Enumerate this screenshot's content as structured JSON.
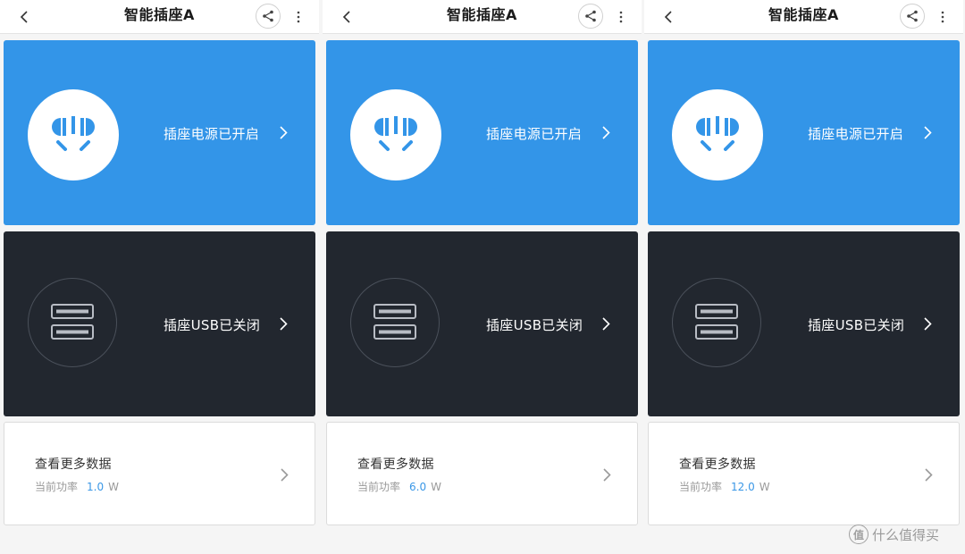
{
  "panels": [
    {
      "title": "智能插座A",
      "power_card": {
        "label": "插座电源已开启",
        "state": "on"
      },
      "usb_card": {
        "label": "插座USB已关闭",
        "state": "off"
      },
      "data_card": {
        "title": "查看更多数据",
        "power_label": "当前功率",
        "power_value": "1.0",
        "power_unit": "W"
      }
    },
    {
      "title": "智能插座A",
      "power_card": {
        "label": "插座电源已开启",
        "state": "on"
      },
      "usb_card": {
        "label": "插座USB已关闭",
        "state": "off"
      },
      "data_card": {
        "title": "查看更多数据",
        "power_label": "当前功率",
        "power_value": "6.0",
        "power_unit": "W"
      }
    },
    {
      "title": "智能插座A",
      "power_card": {
        "label": "插座电源已开启",
        "state": "on"
      },
      "usb_card": {
        "label": "插座USB已关闭",
        "state": "off"
      },
      "data_card": {
        "title": "查看更多数据",
        "power_label": "当前功率",
        "power_value": "12.0",
        "power_unit": "W"
      }
    }
  ],
  "icons": {
    "back": "chevron-left-icon",
    "share": "share-icon",
    "more": "more-vertical-icon",
    "socket": "power-socket-icon",
    "usb": "usb-port-icon",
    "chevron": "chevron-right-icon"
  },
  "colors": {
    "power_card": "#3395e8",
    "usb_card": "#22272f",
    "accent_value": "#3a97e6",
    "background": "#f5f5f5"
  },
  "watermark": {
    "logo_char": "值",
    "text": "什么值得买"
  }
}
